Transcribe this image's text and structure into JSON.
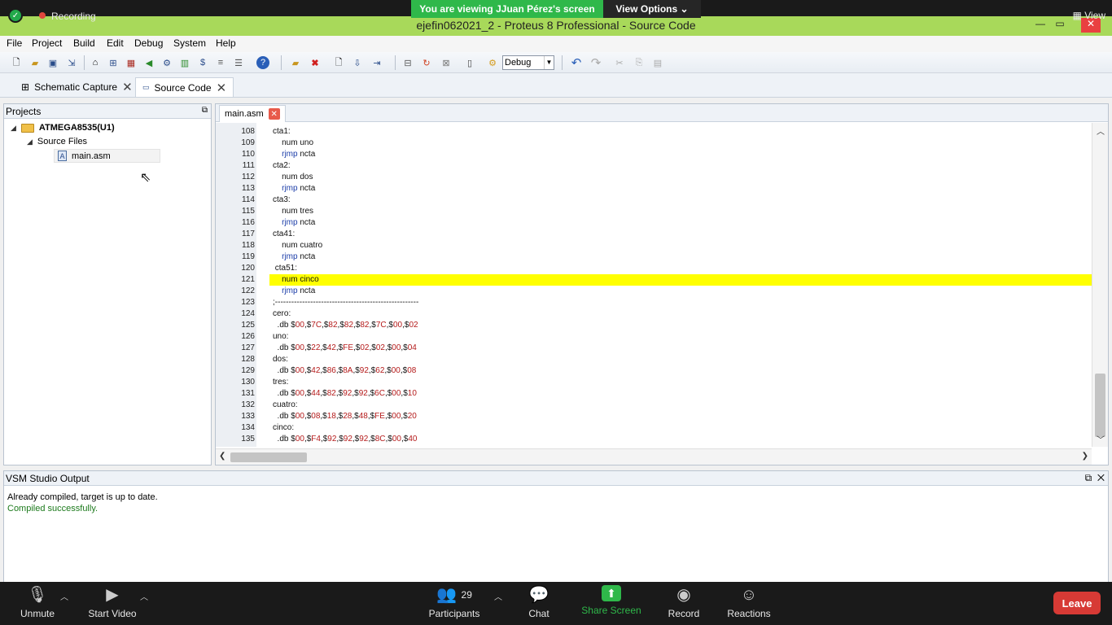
{
  "zoom": {
    "recording_label": "Recording",
    "viewing_banner": "You are viewing JJuan Pérez's screen",
    "view_options": "View Options",
    "view_label": "View",
    "bottom": {
      "unmute": "Unmute",
      "start_video": "Start Video",
      "participants": "Participants",
      "participant_count": "29",
      "chat": "Chat",
      "share_screen": "Share Screen",
      "record": "Record",
      "reactions": "Reactions",
      "leave": "Leave"
    }
  },
  "window": {
    "title": "ejefin062021_2 - Proteus 8 Professional - Source Code"
  },
  "menu": [
    "File",
    "Project",
    "Build",
    "Edit",
    "Debug",
    "System",
    "Help"
  ],
  "toolbar": {
    "config_value": "Debug"
  },
  "doc_tabs": [
    {
      "label": "Schematic Capture"
    },
    {
      "label": "Source Code"
    }
  ],
  "projects": {
    "title": "Projects",
    "root": "ATMEGA8535(U1)",
    "folder": "Source Files",
    "file": "main.asm"
  },
  "editor": {
    "tab_label": "main.asm",
    "lines": [
      {
        "n": "108",
        "t": "cta1:"
      },
      {
        "n": "109",
        "t": "    num uno"
      },
      {
        "n": "110",
        "t": "    rjmp ncta"
      },
      {
        "n": "111",
        "t": "cta2:"
      },
      {
        "n": "112",
        "t": "    num dos"
      },
      {
        "n": "113",
        "t": "    rjmp ncta"
      },
      {
        "n": "114",
        "t": "cta3:"
      },
      {
        "n": "115",
        "t": "    num tres"
      },
      {
        "n": "116",
        "t": "    rjmp ncta"
      },
      {
        "n": "117",
        "t": "cta41:"
      },
      {
        "n": "118",
        "t": "    num cuatro"
      },
      {
        "n": "119",
        "t": "    rjmp ncta"
      },
      {
        "n": "120",
        "t": " cta51:"
      },
      {
        "n": "121",
        "t": "    num cinco"
      },
      {
        "n": "122",
        "t": "    rjmp ncta"
      },
      {
        "n": "123",
        "t": ";-----------------------------------------------------"
      },
      {
        "n": "124",
        "t": "cero:"
      },
      {
        "n": "125",
        "t": "  .db $00,$7C,$82,$82,$82,$7C,$00,$02"
      },
      {
        "n": "126",
        "t": "uno:"
      },
      {
        "n": "127",
        "t": "  .db $00,$22,$42,$FE,$02,$02,$00,$04"
      },
      {
        "n": "128",
        "t": "dos:"
      },
      {
        "n": "129",
        "t": "  .db $00,$42,$86,$8A,$92,$62,$00,$08"
      },
      {
        "n": "130",
        "t": "tres:"
      },
      {
        "n": "131",
        "t": "  .db $00,$44,$82,$92,$92,$6C,$00,$10"
      },
      {
        "n": "132",
        "t": "cuatro:"
      },
      {
        "n": "133",
        "t": "  .db $00,$08,$18,$28,$48,$FE,$00,$20"
      },
      {
        "n": "134",
        "t": "cinco:"
      },
      {
        "n": "135",
        "t": "  .db $00,$F4,$92,$92,$92,$8C,$00,$40"
      }
    ],
    "highlight_line": "121"
  },
  "output": {
    "title": "VSM Studio Output",
    "lines": [
      {
        "text": "Already compiled, target is up to date.",
        "color": "#000000"
      },
      {
        "text": "Compiled successfully.",
        "color": "#1c7a1c"
      }
    ]
  }
}
